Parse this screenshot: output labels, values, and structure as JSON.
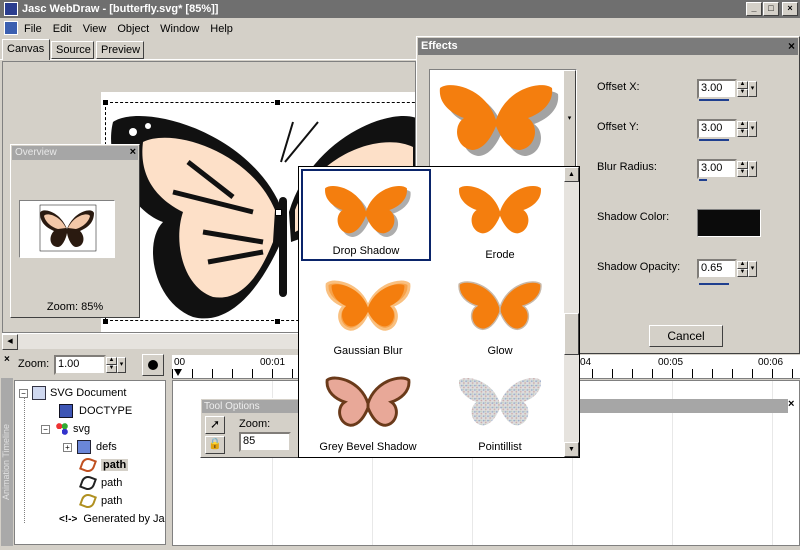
{
  "window": {
    "title": "Jasc WebDraw - [butterfly.svg* [85%]]"
  },
  "menu": [
    "File",
    "Edit",
    "View",
    "Object",
    "Window",
    "Help"
  ],
  "tabs": [
    "Canvas",
    "Source",
    "Preview"
  ],
  "overview": {
    "title": "Overview",
    "zoom_label": "Zoom: 85%"
  },
  "timeline": {
    "zoom_label": "Zoom:",
    "zoom_value": "1.00",
    "ruler": [
      "00",
      "00:01",
      "04",
      "00:05",
      "00:06"
    ],
    "side_label": "Animation Timeline"
  },
  "tree": {
    "items": [
      {
        "label": "SVG Document"
      },
      {
        "label": "DOCTYPE"
      },
      {
        "label": "svg"
      },
      {
        "label": "defs"
      },
      {
        "label": "path"
      },
      {
        "label": "path"
      },
      {
        "label": "path"
      },
      {
        "label": "Generated by Ja"
      }
    ]
  },
  "tool_options": {
    "title": "Tool Options",
    "zoom_label": "Zoom:",
    "zoom_value": "85"
  },
  "effects": {
    "title": "Effects",
    "offset_x": {
      "label": "Offset X:",
      "value": "3.00"
    },
    "offset_y": {
      "label": "Offset Y:",
      "value": "3.00"
    },
    "blur_radius": {
      "label": "Blur Radius:",
      "value": "3.00"
    },
    "shadow_color": {
      "label": "Shadow Color:",
      "color": "#0b0b0b"
    },
    "shadow_opacity": {
      "label": "Shadow Opacity:",
      "value": "0.65"
    },
    "cancel": "Cancel",
    "presets": [
      "Drop Shadow",
      "Erode",
      "Gaussian Blur",
      "Glow",
      "Grey Bevel Shadow",
      "Pointillist"
    ],
    "selected": "Drop Shadow"
  },
  "colors": {
    "accent": "#0a246a",
    "butterfly": "#f47e0e"
  }
}
